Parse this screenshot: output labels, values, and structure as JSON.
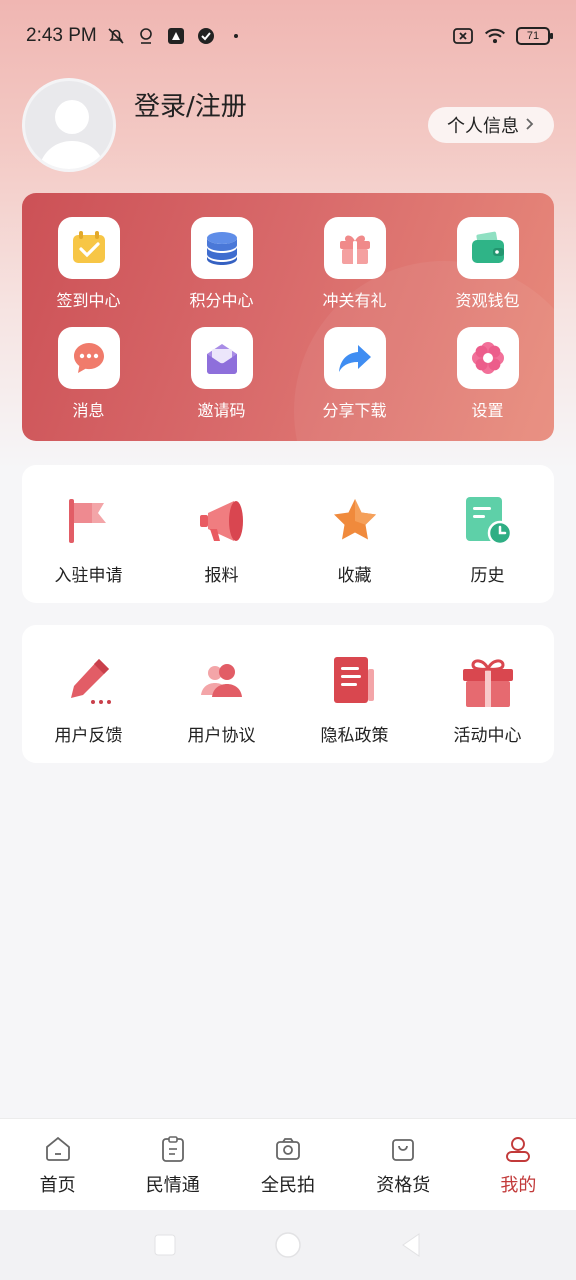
{
  "status_bar": {
    "time": "2:43 PM",
    "battery": "71"
  },
  "profile": {
    "login_label": "登录/注册",
    "info_button": "个人信息"
  },
  "quick_actions": [
    {
      "label": "签到中心",
      "icon": "calendar-check-icon"
    },
    {
      "label": "积分中心",
      "icon": "coins-stack-icon"
    },
    {
      "label": "冲关有礼",
      "icon": "gift-box-icon"
    },
    {
      "label": "资观钱包",
      "icon": "wallet-icon"
    },
    {
      "label": "消息",
      "icon": "chat-bubble-icon"
    },
    {
      "label": "邀请码",
      "icon": "envelope-open-icon"
    },
    {
      "label": "分享下载",
      "icon": "share-arrow-icon"
    },
    {
      "label": "设置",
      "icon": "gear-icon"
    }
  ],
  "services_1": [
    {
      "label": "入驻申请",
      "icon": "flag-icon"
    },
    {
      "label": "报料",
      "icon": "megaphone-icon"
    },
    {
      "label": "收藏",
      "icon": "star-icon"
    },
    {
      "label": "历史",
      "icon": "history-icon"
    }
  ],
  "services_2": [
    {
      "label": "用户反馈",
      "icon": "pencil-icon"
    },
    {
      "label": "用户协议",
      "icon": "users-icon"
    },
    {
      "label": "隐私政策",
      "icon": "document-icon"
    },
    {
      "label": "活动中心",
      "icon": "gift-icon"
    }
  ],
  "tabs": [
    {
      "label": "首页",
      "icon": "home-icon"
    },
    {
      "label": "民情通",
      "icon": "clipboard-icon"
    },
    {
      "label": "全民拍",
      "icon": "camera-icon"
    },
    {
      "label": "资格货",
      "icon": "shopping-bag-icon"
    },
    {
      "label": "我的",
      "icon": "person-icon",
      "active": true
    }
  ],
  "colors": {
    "accent": "#c23a3a",
    "card_red": "#cc5156",
    "card_peach": "#e88b7c"
  }
}
